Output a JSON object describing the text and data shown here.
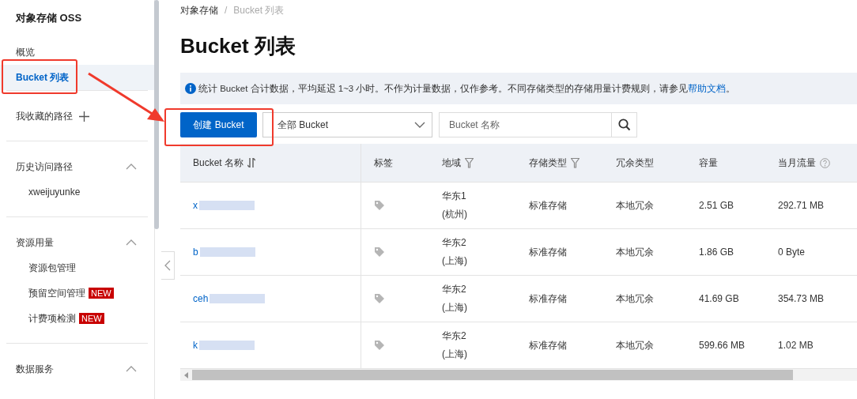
{
  "sidebar": {
    "title": "对象存储 OSS",
    "items": [
      {
        "label": "概览",
        "selected": false
      },
      {
        "label": "Bucket 列表",
        "selected": true
      }
    ],
    "sections": [
      {
        "title": "我收藏的路径",
        "kind": "add"
      },
      {
        "title": "历史访问路径",
        "kind": "collapsible",
        "expanded": true,
        "children": [
          {
            "label": "xweijuyunke"
          }
        ]
      },
      {
        "title": "资源用量",
        "kind": "collapsible",
        "expanded": true,
        "children": [
          {
            "label": "资源包管理"
          },
          {
            "label": "预留空间管理",
            "badge": "NEW"
          },
          {
            "label": "计费项检测",
            "badge": "NEW"
          }
        ]
      },
      {
        "title": "数据服务",
        "kind": "collapsible",
        "expanded": true
      }
    ]
  },
  "breadcrumb": [
    "对象存储",
    "Bucket 列表"
  ],
  "breadcrumb_separator": "/",
  "page_title": "Bucket 列表",
  "notice": {
    "text": "统计 Bucket 合计数据，平均延迟 1~3 小时。不作为计量数据，仅作参考。不同存储类型的存储用量计费规则，请参见",
    "link": "帮助文档",
    "tail": "。"
  },
  "toolbar": {
    "create_button": "创建 Bucket",
    "filter_value": "全部 Bucket",
    "search": {
      "placeholder": "Bucket 名称"
    }
  },
  "table": {
    "columns": [
      {
        "label": "Bucket 名称"
      },
      {
        "label": "标签"
      },
      {
        "label": "地域"
      },
      {
        "label": "存储类型"
      },
      {
        "label": "冗余类型"
      },
      {
        "label": "容量"
      },
      {
        "label": "当月流量"
      }
    ],
    "rows": [
      {
        "name": "x",
        "region": "华东1",
        "region_city": "(杭州)",
        "storage_type": "标准存储",
        "redundancy": "本地冗余",
        "capacity": "2.51 GB",
        "traffic": "292.71 MB"
      },
      {
        "name": "b",
        "region": "华东2",
        "region_city": "(上海)",
        "storage_type": "标准存储",
        "redundancy": "本地冗余",
        "capacity": "1.86 GB",
        "traffic": "0 Byte"
      },
      {
        "name": "ceh",
        "region": "华东2",
        "region_city": "(上海)",
        "storage_type": "标准存储",
        "redundancy": "本地冗余",
        "capacity": "41.69 GB",
        "traffic": "354.73 MB"
      },
      {
        "name": "k",
        "region": "华东2",
        "region_city": "(上海)",
        "storage_type": "标准存储",
        "redundancy": "本地冗余",
        "capacity": "599.66 MB",
        "traffic": "1.02 MB"
      }
    ]
  }
}
